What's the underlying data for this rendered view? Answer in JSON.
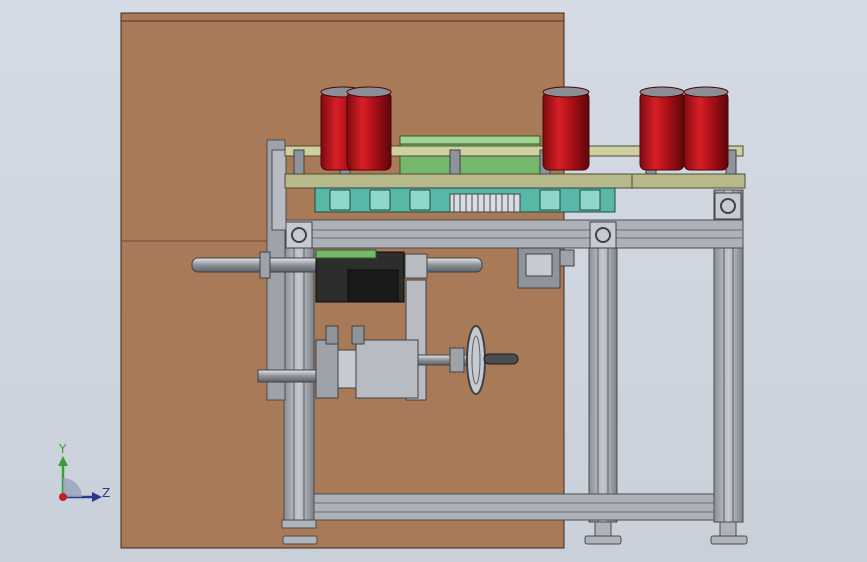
{
  "viewport": {
    "background_top": "#d5dbe4",
    "background_bottom": "#c9d0da",
    "model_colors": {
      "wood_panel": "#a87a57",
      "aluminum_frame": "#9ea3aa",
      "can_red": "#c0141a",
      "conveyor_plate": "#b8b98a",
      "green_gear_box": "#76b86b",
      "teal_bracket": "#59b7a8",
      "motor_dark": "#2d2d2d"
    }
  },
  "triad": {
    "y_axis_label": "Y",
    "z_axis_label": "Z",
    "y_axis_color": "#3c9c3c",
    "z_axis_color": "#2a3b8f"
  }
}
